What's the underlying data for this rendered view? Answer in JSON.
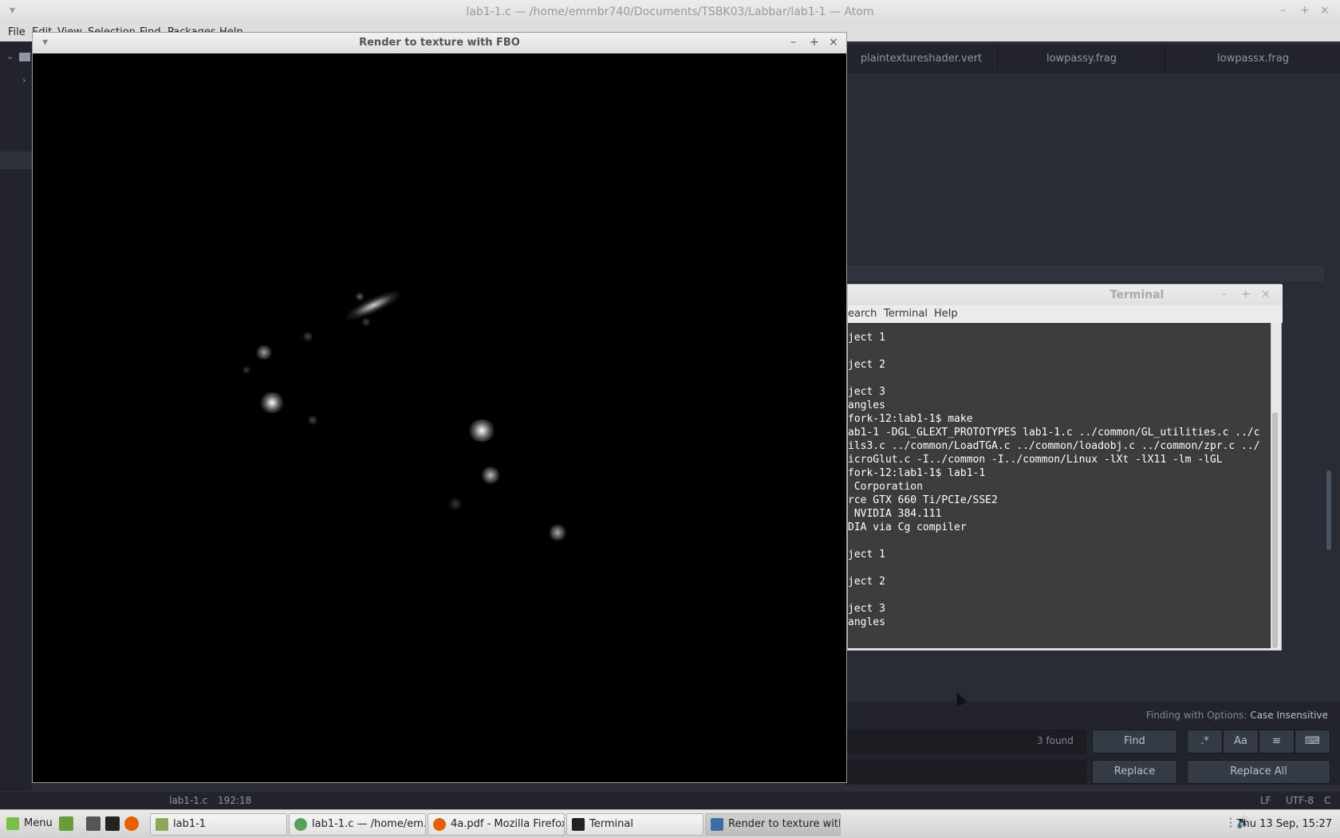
{
  "atom": {
    "title": "lab1-1.c — /home/emmbr740/Documents/TSBK03/Labbar/lab1-1 — Atom",
    "window_buttons": [
      "–",
      "+",
      "×"
    ],
    "menu": [
      "File",
      "Edit",
      "View",
      "Selection",
      "Find",
      "Packages",
      "Help"
    ],
    "tabs": [
      "plaintextureshader.vert",
      "lowpassy.frag",
      "lowpassx.frag"
    ],
    "find": {
      "options_label": "Finding with Options:",
      "options_value": "Case Insensitive",
      "count": "3 found",
      "find_button": "Find",
      "replace_button": "Replace",
      "replace_all_button": "Replace All",
      "option_buttons": [
        ".*",
        "Aa",
        "≡",
        "⌨"
      ]
    },
    "status": {
      "file": "lab1-1.c",
      "cursor": "192:18",
      "line_ending": "LF",
      "encoding": "UTF-8",
      "grammar": "C"
    }
  },
  "render_window": {
    "title": "Render to texture with FBO",
    "buttons": [
      "–",
      "+",
      "×"
    ]
  },
  "terminal": {
    "title": "Terminal",
    "buttons": [
      "–",
      "+",
      "×"
    ],
    "menu": [
      "earch",
      "Terminal",
      "Help"
    ],
    "lines": [
      "ject 1",
      "",
      "ject 2",
      "",
      "ject 3",
      "angles",
      "fork-12:lab1-1$ make",
      "ab1-1 -DGL_GLEXT_PROTOTYPES lab1-1.c ../common/GL_utilities.c ../c",
      "ils3.c ../common/LoadTGA.c ../common/loadobj.c ../common/zpr.c ../",
      "icroGlut.c -I../common -I../common/Linux -lXt -lX11 -lm -lGL",
      "fork-12:lab1-1$ lab1-1",
      " Corporation",
      "rce GTX 660 Ti/PCIe/SSE2",
      " NVIDIA 384.111",
      "DIA via Cg compiler",
      "",
      "ject 1",
      "",
      "ject 2",
      "",
      "ject 3",
      "angles"
    ]
  },
  "taskbar": {
    "menu_label": "Menu",
    "items": [
      {
        "label": "lab1-1",
        "icon": "folder-icon"
      },
      {
        "label": "lab1-1.c — /home/em...",
        "icon": "atom-icon"
      },
      {
        "label": "4a.pdf - Mozilla Firefox",
        "icon": "firefox-icon"
      },
      {
        "label": "Terminal",
        "icon": "terminal-icon"
      },
      {
        "label": "Render to texture with...",
        "icon": "window-icon"
      }
    ],
    "clock": "Thu 13 Sep, 15:27"
  },
  "colors": {
    "atom_bg": "#282c34",
    "mint_green": "#7ac143",
    "terminal_bg": "#3c3c3c"
  }
}
